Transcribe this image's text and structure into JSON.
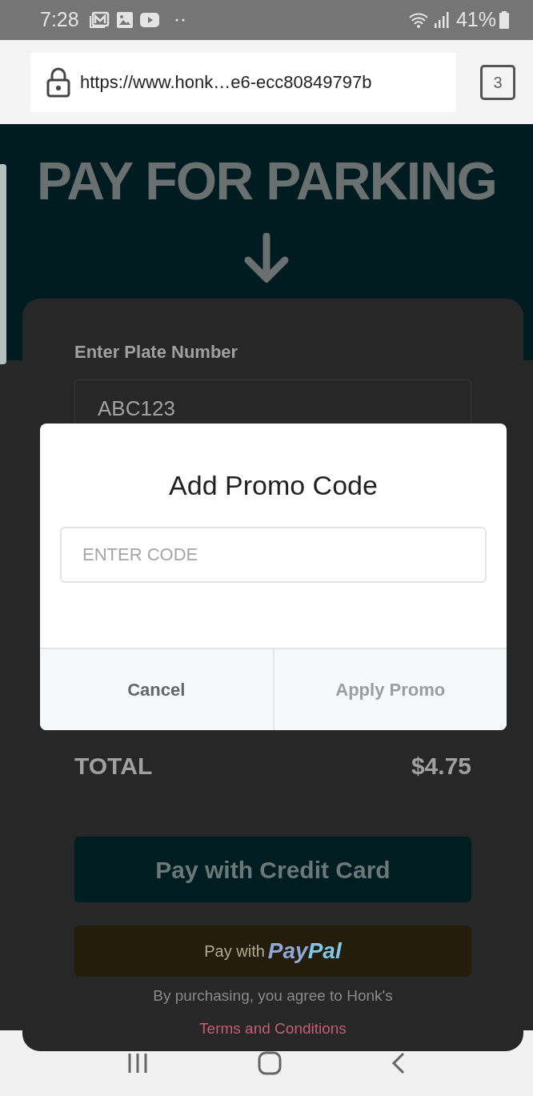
{
  "status_bar": {
    "time": "7:28",
    "battery": "41%"
  },
  "browser": {
    "url": "https://www.honk…e6-ecc80849797b",
    "tab_count": "3"
  },
  "page": {
    "title": "PAY FOR PARKING",
    "plate_label": "Enter Plate Number",
    "plate_value": "ABC123",
    "total_label": "TOTAL",
    "total_value": "$4.75",
    "credit_button": "Pay with Credit Card",
    "paypal_prefix": "Pay with",
    "paypal_brand": [
      "Pay",
      "Pal"
    ],
    "agreement": "By purchasing, you agree to Honk's",
    "terms_link": "Terms and Conditions"
  },
  "dialog": {
    "title": "Add Promo Code",
    "field": {
      "placeholder": "ENTER CODE"
    },
    "buttons": [
      {
        "label": "Cancel",
        "disabled": false
      },
      {
        "label": "Apply Promo",
        "disabled": true
      }
    ]
  }
}
